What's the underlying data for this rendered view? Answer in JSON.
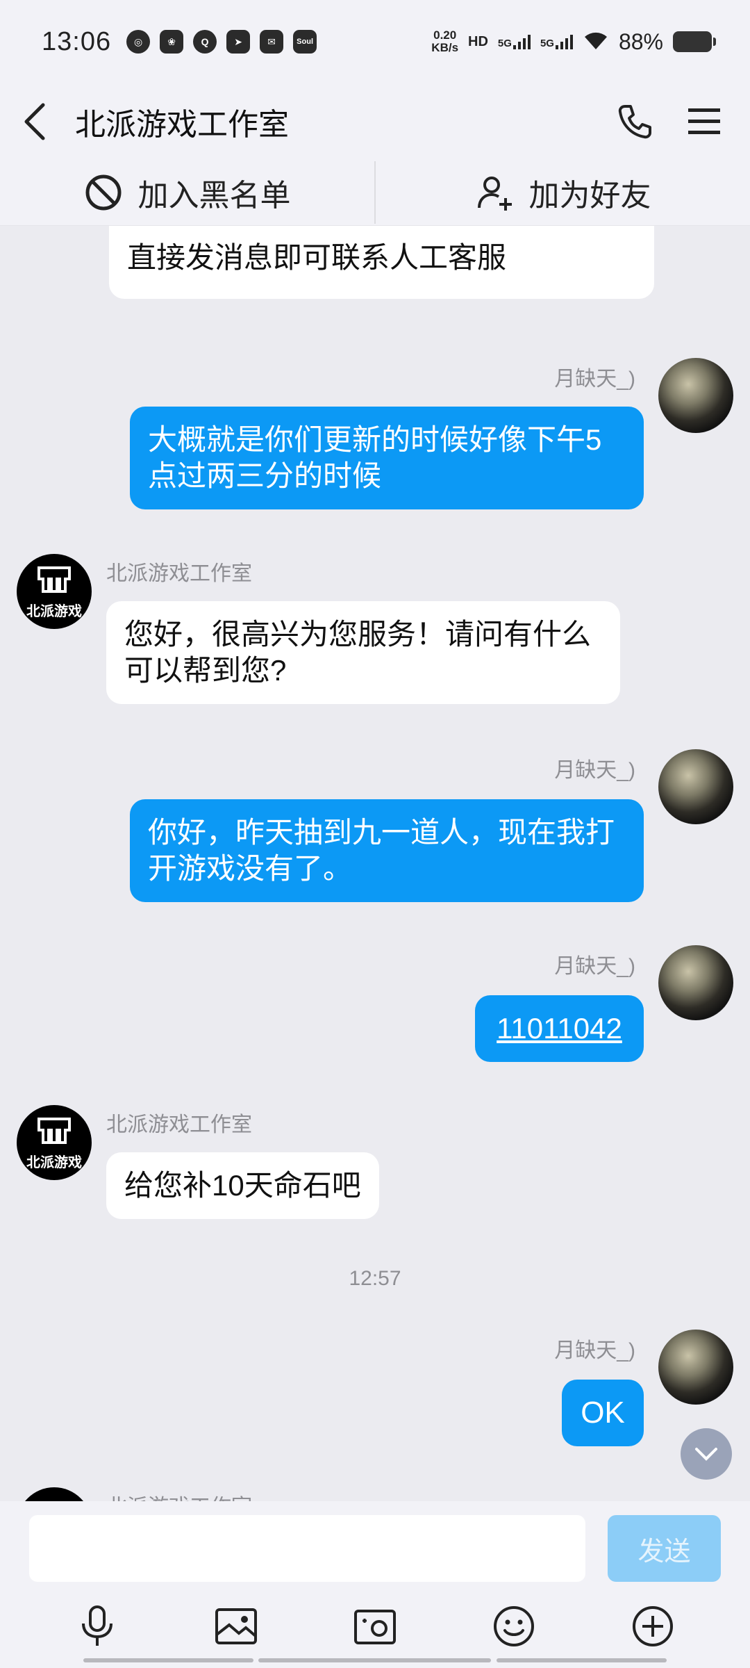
{
  "status_bar": {
    "time": "13:06",
    "net_speed_value": "0.20",
    "net_speed_unit": "KB/s",
    "hd_label": "HD",
    "signal_1": "5G",
    "signal_2": "5G",
    "battery": "88%",
    "app_icons": [
      "app-icon-1",
      "app-icon-2",
      "qq-icon",
      "telegram-icon",
      "mail-icon",
      "soul-icon"
    ],
    "soul_label": "Soul"
  },
  "header": {
    "title": "北派游戏工作室"
  },
  "action_bar": {
    "block_label": "加入黑名单",
    "add_friend_label": "加为好友"
  },
  "messages": {
    "m0_text": "直接发消息即可联系人工客服",
    "m1_sender": "月缺天_)",
    "m1_text": "大概就是你们更新的时候好像下午5点过两三分的时候",
    "m2_sender": "北派游戏工作室",
    "m2_text": "您好，很高兴为您服务！请问有什么可以帮到您?",
    "m3_sender": "月缺天_)",
    "m3_text": "你好，昨天抽到九一道人，现在我打开游戏没有了。",
    "m4_sender": "月缺天_)",
    "m4_text": "11011042",
    "m5_sender": "北派游戏工作室",
    "m5_text": "给您补10天命石吧",
    "timestamp": "12:57",
    "m6_sender": "月缺天_)",
    "m6_text": "OK",
    "m7_sender": "北派游戏工作室"
  },
  "bot_avatar_text": "北派游戏",
  "input": {
    "value": "",
    "send_label": "发送"
  },
  "colors": {
    "outgoing_bubble": "#0c99f5",
    "incoming_bubble": "#ffffff",
    "send_disabled": "#8ccdf7",
    "background": "#ebebf0"
  }
}
